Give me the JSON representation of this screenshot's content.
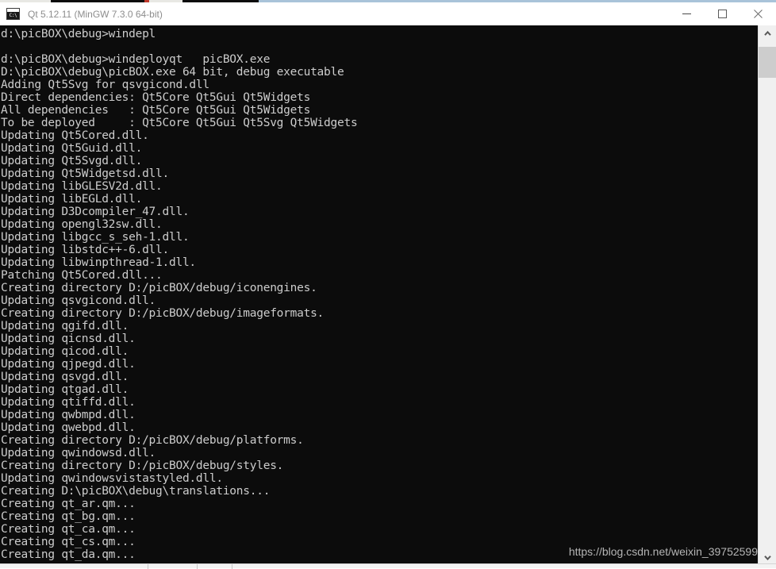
{
  "window": {
    "title": "Qt 5.12.11 (MinGW 7.3.0 64-bit)",
    "icon": "cmd-console-icon",
    "icon_glyph": "C:\\",
    "controls": {
      "minimize_label": "Minimize",
      "maximize_label": "Maximize",
      "close_label": "Close"
    },
    "colors": {
      "titlebar_bg": "#ffffff",
      "title_text": "#8d8d8d",
      "console_bg": "#0c0c0c",
      "console_text": "#cccccc",
      "scrollbar_track": "#f0f0f0",
      "scrollbar_thumb": "#cdcdcd",
      "desktop_accent": "#a9c3d9"
    }
  },
  "console": {
    "lines": [
      "d:\\picBOX\\debug>windepl",
      "",
      "d:\\picBOX\\debug>windeployqt   picBOX.exe",
      "D:\\picBOX\\debug\\picBOX.exe 64 bit, debug executable",
      "Adding Qt5Svg for qsvgicond.dll",
      "Direct dependencies: Qt5Core Qt5Gui Qt5Widgets",
      "All dependencies   : Qt5Core Qt5Gui Qt5Widgets",
      "To be deployed     : Qt5Core Qt5Gui Qt5Svg Qt5Widgets",
      "Updating Qt5Cored.dll.",
      "Updating Qt5Guid.dll.",
      "Updating Qt5Svgd.dll.",
      "Updating Qt5Widgetsd.dll.",
      "Updating libGLESV2d.dll.",
      "Updating libEGLd.dll.",
      "Updating D3Dcompiler_47.dll.",
      "Updating opengl32sw.dll.",
      "Updating libgcc_s_seh-1.dll.",
      "Updating libstdc++-6.dll.",
      "Updating libwinpthread-1.dll.",
      "Patching Qt5Cored.dll...",
      "Creating directory D:/picBOX/debug/iconengines.",
      "Updating qsvgicond.dll.",
      "Creating directory D:/picBOX/debug/imageformats.",
      "Updating qgifd.dll.",
      "Updating qicnsd.dll.",
      "Updating qicod.dll.",
      "Updating qjpegd.dll.",
      "Updating qsvgd.dll.",
      "Updating qtgad.dll.",
      "Updating qtiffd.dll.",
      "Updating qwbmpd.dll.",
      "Updating qwebpd.dll.",
      "Creating directory D:/picBOX/debug/platforms.",
      "Updating qwindowsd.dll.",
      "Creating directory D:/picBOX/debug/styles.",
      "Updating qwindowsvistastyled.dll.",
      "Creating D:\\picBOX\\debug\\translations...",
      "Creating qt_ar.qm...",
      "Creating qt_bg.qm...",
      "Creating qt_ca.qm...",
      "Creating qt_cs.qm...",
      "Creating qt_da.qm..."
    ]
  },
  "watermark": {
    "text": "https://blog.csdn.net/weixin_39752599"
  },
  "scrollbar": {
    "up_arrow": "chevron-up-icon",
    "down_arrow": "chevron-down-icon"
  }
}
